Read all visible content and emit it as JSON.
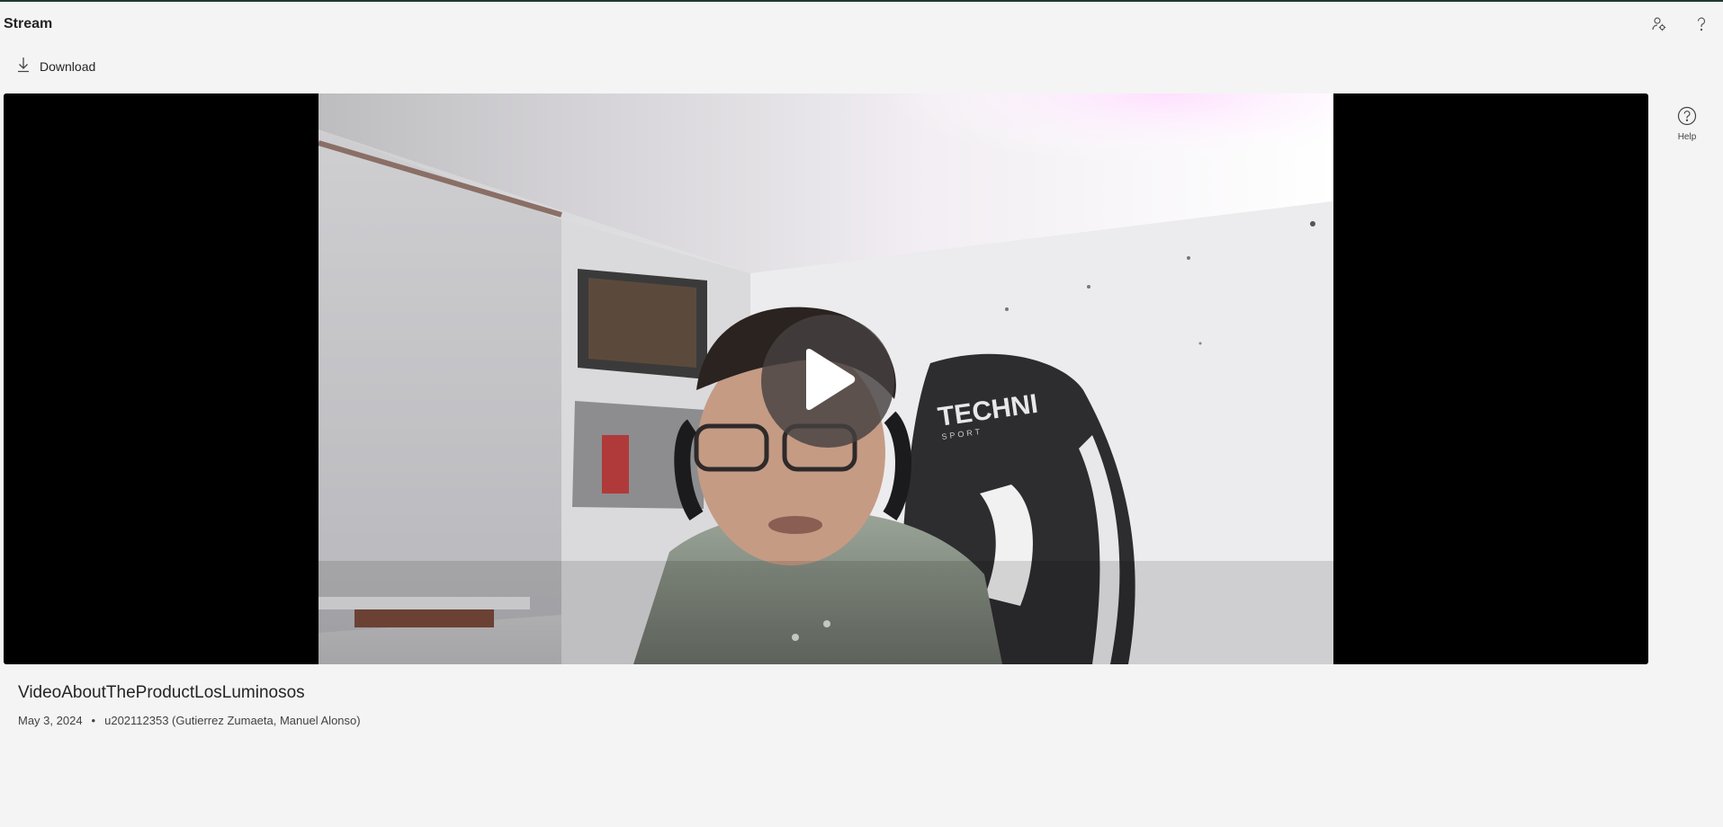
{
  "app": {
    "title": "Stream"
  },
  "header": {
    "share_icon": "people-settings-icon",
    "help_icon": "question-icon"
  },
  "toolbar": {
    "download_label": "Download",
    "download_icon": "download-icon"
  },
  "player": {
    "play_icon": "play-icon",
    "chair_text": "TECHNI",
    "chair_subtext": "SPORT"
  },
  "side_panel": {
    "help_label": "Help",
    "help_icon": "help-circle-icon"
  },
  "video": {
    "title": "VideoAboutTheProductLosLuminosos",
    "date": "May 3, 2024",
    "separator": "•",
    "owner": "u202112353 (Gutierrez Zumaeta, Manuel Alonso)"
  },
  "colors": {
    "background": "#f4f4f4",
    "player_bg": "#000000",
    "accent_top": "#1f3b2e"
  }
}
